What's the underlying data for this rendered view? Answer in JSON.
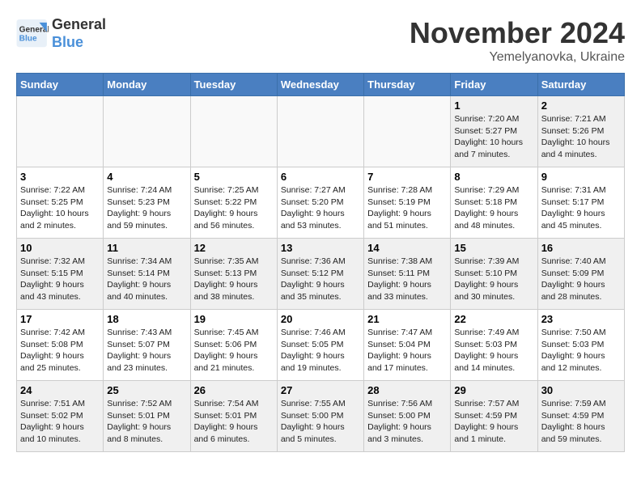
{
  "header": {
    "logo_line1": "General",
    "logo_line2": "Blue",
    "month": "November 2024",
    "location": "Yemelyanovka, Ukraine"
  },
  "weekdays": [
    "Sunday",
    "Monday",
    "Tuesday",
    "Wednesday",
    "Thursday",
    "Friday",
    "Saturday"
  ],
  "weeks": [
    [
      {
        "day": "",
        "info": ""
      },
      {
        "day": "",
        "info": ""
      },
      {
        "day": "",
        "info": ""
      },
      {
        "day": "",
        "info": ""
      },
      {
        "day": "",
        "info": ""
      },
      {
        "day": "1",
        "info": "Sunrise: 7:20 AM\nSunset: 5:27 PM\nDaylight: 10 hours\nand 7 minutes."
      },
      {
        "day": "2",
        "info": "Sunrise: 7:21 AM\nSunset: 5:26 PM\nDaylight: 10 hours\nand 4 minutes."
      }
    ],
    [
      {
        "day": "3",
        "info": "Sunrise: 7:22 AM\nSunset: 5:25 PM\nDaylight: 10 hours\nand 2 minutes."
      },
      {
        "day": "4",
        "info": "Sunrise: 7:24 AM\nSunset: 5:23 PM\nDaylight: 9 hours\nand 59 minutes."
      },
      {
        "day": "5",
        "info": "Sunrise: 7:25 AM\nSunset: 5:22 PM\nDaylight: 9 hours\nand 56 minutes."
      },
      {
        "day": "6",
        "info": "Sunrise: 7:27 AM\nSunset: 5:20 PM\nDaylight: 9 hours\nand 53 minutes."
      },
      {
        "day": "7",
        "info": "Sunrise: 7:28 AM\nSunset: 5:19 PM\nDaylight: 9 hours\nand 51 minutes."
      },
      {
        "day": "8",
        "info": "Sunrise: 7:29 AM\nSunset: 5:18 PM\nDaylight: 9 hours\nand 48 minutes."
      },
      {
        "day": "9",
        "info": "Sunrise: 7:31 AM\nSunset: 5:17 PM\nDaylight: 9 hours\nand 45 minutes."
      }
    ],
    [
      {
        "day": "10",
        "info": "Sunrise: 7:32 AM\nSunset: 5:15 PM\nDaylight: 9 hours\nand 43 minutes."
      },
      {
        "day": "11",
        "info": "Sunrise: 7:34 AM\nSunset: 5:14 PM\nDaylight: 9 hours\nand 40 minutes."
      },
      {
        "day": "12",
        "info": "Sunrise: 7:35 AM\nSunset: 5:13 PM\nDaylight: 9 hours\nand 38 minutes."
      },
      {
        "day": "13",
        "info": "Sunrise: 7:36 AM\nSunset: 5:12 PM\nDaylight: 9 hours\nand 35 minutes."
      },
      {
        "day": "14",
        "info": "Sunrise: 7:38 AM\nSunset: 5:11 PM\nDaylight: 9 hours\nand 33 minutes."
      },
      {
        "day": "15",
        "info": "Sunrise: 7:39 AM\nSunset: 5:10 PM\nDaylight: 9 hours\nand 30 minutes."
      },
      {
        "day": "16",
        "info": "Sunrise: 7:40 AM\nSunset: 5:09 PM\nDaylight: 9 hours\nand 28 minutes."
      }
    ],
    [
      {
        "day": "17",
        "info": "Sunrise: 7:42 AM\nSunset: 5:08 PM\nDaylight: 9 hours\nand 25 minutes."
      },
      {
        "day": "18",
        "info": "Sunrise: 7:43 AM\nSunset: 5:07 PM\nDaylight: 9 hours\nand 23 minutes."
      },
      {
        "day": "19",
        "info": "Sunrise: 7:45 AM\nSunset: 5:06 PM\nDaylight: 9 hours\nand 21 minutes."
      },
      {
        "day": "20",
        "info": "Sunrise: 7:46 AM\nSunset: 5:05 PM\nDaylight: 9 hours\nand 19 minutes."
      },
      {
        "day": "21",
        "info": "Sunrise: 7:47 AM\nSunset: 5:04 PM\nDaylight: 9 hours\nand 17 minutes."
      },
      {
        "day": "22",
        "info": "Sunrise: 7:49 AM\nSunset: 5:03 PM\nDaylight: 9 hours\nand 14 minutes."
      },
      {
        "day": "23",
        "info": "Sunrise: 7:50 AM\nSunset: 5:03 PM\nDaylight: 9 hours\nand 12 minutes."
      }
    ],
    [
      {
        "day": "24",
        "info": "Sunrise: 7:51 AM\nSunset: 5:02 PM\nDaylight: 9 hours\nand 10 minutes."
      },
      {
        "day": "25",
        "info": "Sunrise: 7:52 AM\nSunset: 5:01 PM\nDaylight: 9 hours\nand 8 minutes."
      },
      {
        "day": "26",
        "info": "Sunrise: 7:54 AM\nSunset: 5:01 PM\nDaylight: 9 hours\nand 6 minutes."
      },
      {
        "day": "27",
        "info": "Sunrise: 7:55 AM\nSunset: 5:00 PM\nDaylight: 9 hours\nand 5 minutes."
      },
      {
        "day": "28",
        "info": "Sunrise: 7:56 AM\nSunset: 5:00 PM\nDaylight: 9 hours\nand 3 minutes."
      },
      {
        "day": "29",
        "info": "Sunrise: 7:57 AM\nSunset: 4:59 PM\nDaylight: 9 hours\nand 1 minute."
      },
      {
        "day": "30",
        "info": "Sunrise: 7:59 AM\nSunset: 4:59 PM\nDaylight: 8 hours\nand 59 minutes."
      }
    ]
  ]
}
